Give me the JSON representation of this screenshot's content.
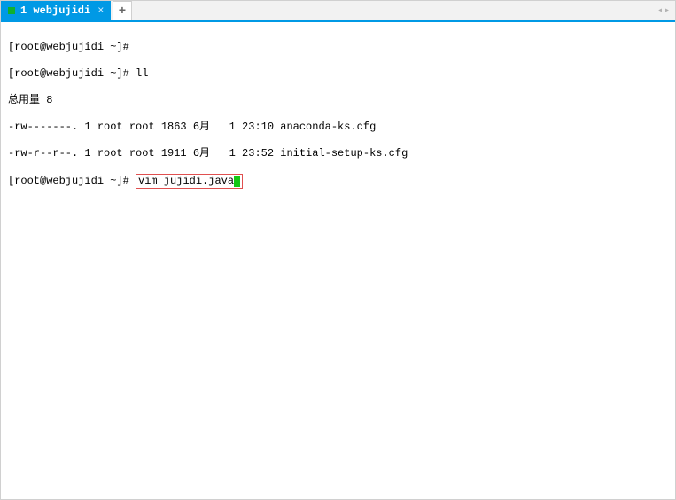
{
  "tab": {
    "title": "1 webjujidi",
    "close": "×"
  },
  "newtab": {
    "label": "+"
  },
  "nav": {
    "left": "◂",
    "right": "▸"
  },
  "terminal": {
    "lines": [
      {
        "prompt": "[root@webjujidi ~]#",
        "cmd": ""
      },
      {
        "prompt": "[root@webjujidi ~]#",
        "cmd": " ll"
      }
    ],
    "total": "总用量 8",
    "files": [
      "-rw-------. 1 root root 1863 6月   1 23:10 anaconda-ks.cfg",
      "-rw-r--r--. 1 root root 1911 6月   1 23:52 initial-setup-ks.cfg"
    ],
    "current": {
      "prompt": "[root@webjujidi ~]#",
      "cmd": "vim jujidi.java"
    }
  }
}
